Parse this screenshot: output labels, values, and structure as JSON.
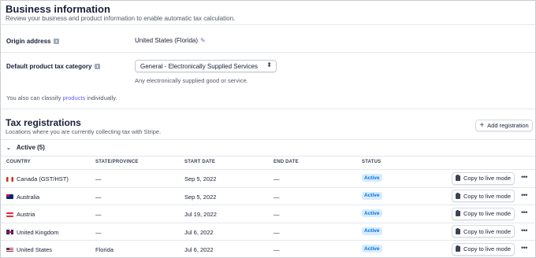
{
  "business": {
    "title": "Business information",
    "subtitle": "Review your business and product information to enable automatic tax calculation.",
    "origin_label": "Origin address",
    "origin_value": "United States (Florida)",
    "category_label": "Default product tax category",
    "category_value": "General - Electronically Supplied Services",
    "category_help": "Any electronically supplied good or service.",
    "classify_prefix": "You also can classify ",
    "classify_link": "products",
    "classify_suffix": " individually."
  },
  "tax": {
    "title": "Tax registrations",
    "subtitle": "Locations where you are currently collecting tax with Stripe.",
    "add_button": "Add registration",
    "active_label": "Active (5)",
    "columns": [
      "COUNTRY",
      "STATE/PROVINCE",
      "START DATE",
      "END DATE",
      "STATUS"
    ],
    "rows": [
      {
        "country": "Canada (GST/HST)",
        "flag": "canada-flag",
        "state": "—",
        "start": "Sep 5, 2022",
        "end": "—",
        "status": "Active",
        "action": "Copy to live mode"
      },
      {
        "country": "Australia",
        "flag": "australia-flag",
        "state": "—",
        "start": "Sep 5, 2022",
        "end": "—",
        "status": "Active",
        "action": "Copy to live mode"
      },
      {
        "country": "Austria",
        "flag": "austria-flag",
        "state": "—",
        "start": "Jul 19, 2022",
        "end": "—",
        "status": "Active",
        "action": "Copy to live mode"
      },
      {
        "country": "United Kingdom",
        "flag": "uk-flag",
        "state": "—",
        "start": "Jul 6, 2022",
        "end": "—",
        "status": "Active",
        "action": "Copy to live mode"
      },
      {
        "country": "United States",
        "flag": "us-flag",
        "state": "Florida",
        "start": "Jul 6, 2022",
        "end": "—",
        "status": "Active",
        "action": "Copy to live mode"
      }
    ]
  },
  "colors": {
    "accent": "#635bff",
    "badge_text": "#0570de",
    "badge_bg": "#d6ecff"
  }
}
